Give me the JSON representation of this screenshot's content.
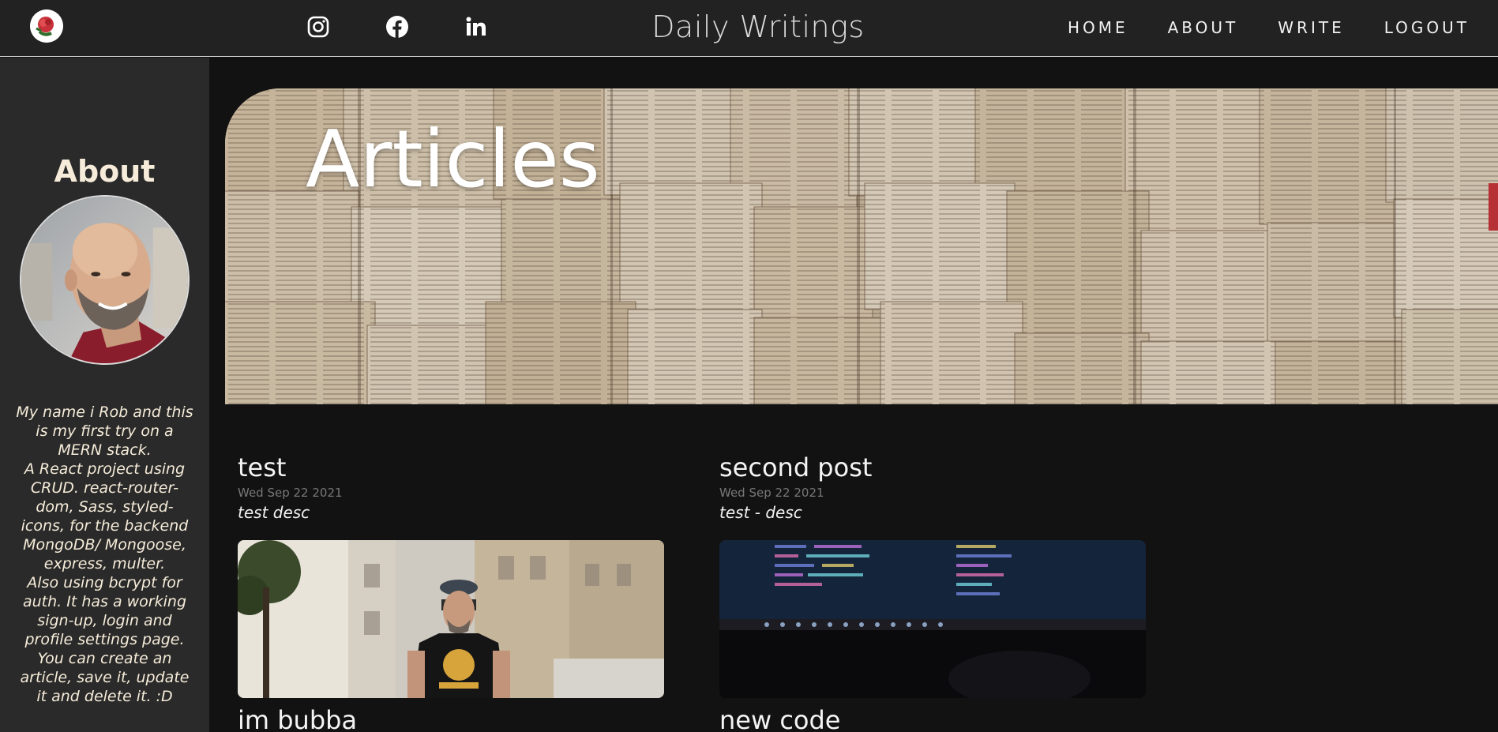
{
  "header": {
    "brand": "Daily Writings",
    "nav": [
      {
        "label": "HOME"
      },
      {
        "label": "ABOUT"
      },
      {
        "label": "WRITE"
      },
      {
        "label": "LOGOUT"
      }
    ],
    "social": [
      {
        "icon": "instagram-icon"
      },
      {
        "icon": "facebook-icon"
      },
      {
        "icon": "linkedin-icon"
      }
    ]
  },
  "sidebar": {
    "title": "About",
    "bio": "My name i Rob and this\nis my first try on a\nMERN stack.\nA React project using\nCRUD. react-router-\ndom, Sass, styled-\nicons, for the backend\nMongoDB/ Mongoose,\nexpress, multer.\nAlso using bcrypt for\nauth. It has a working\nsign-up, login and\nprofile settings page.\nYou can create an\narticle, save it, update\nit and delete it. :D"
  },
  "hero": {
    "title": "Articles"
  },
  "posts": [
    {
      "title": "test",
      "date": "Wed Sep 22 2021",
      "desc": "test desc"
    },
    {
      "title": "second post",
      "date": "Wed Sep 22 2021",
      "desc": "test - desc"
    },
    {
      "title": "im bubba"
    },
    {
      "title": "new code"
    }
  ],
  "colors": {
    "topbar": "#222222",
    "sidebar": "#2a2a2a",
    "background": "#121212",
    "accent_text": "#f6ecd9"
  }
}
